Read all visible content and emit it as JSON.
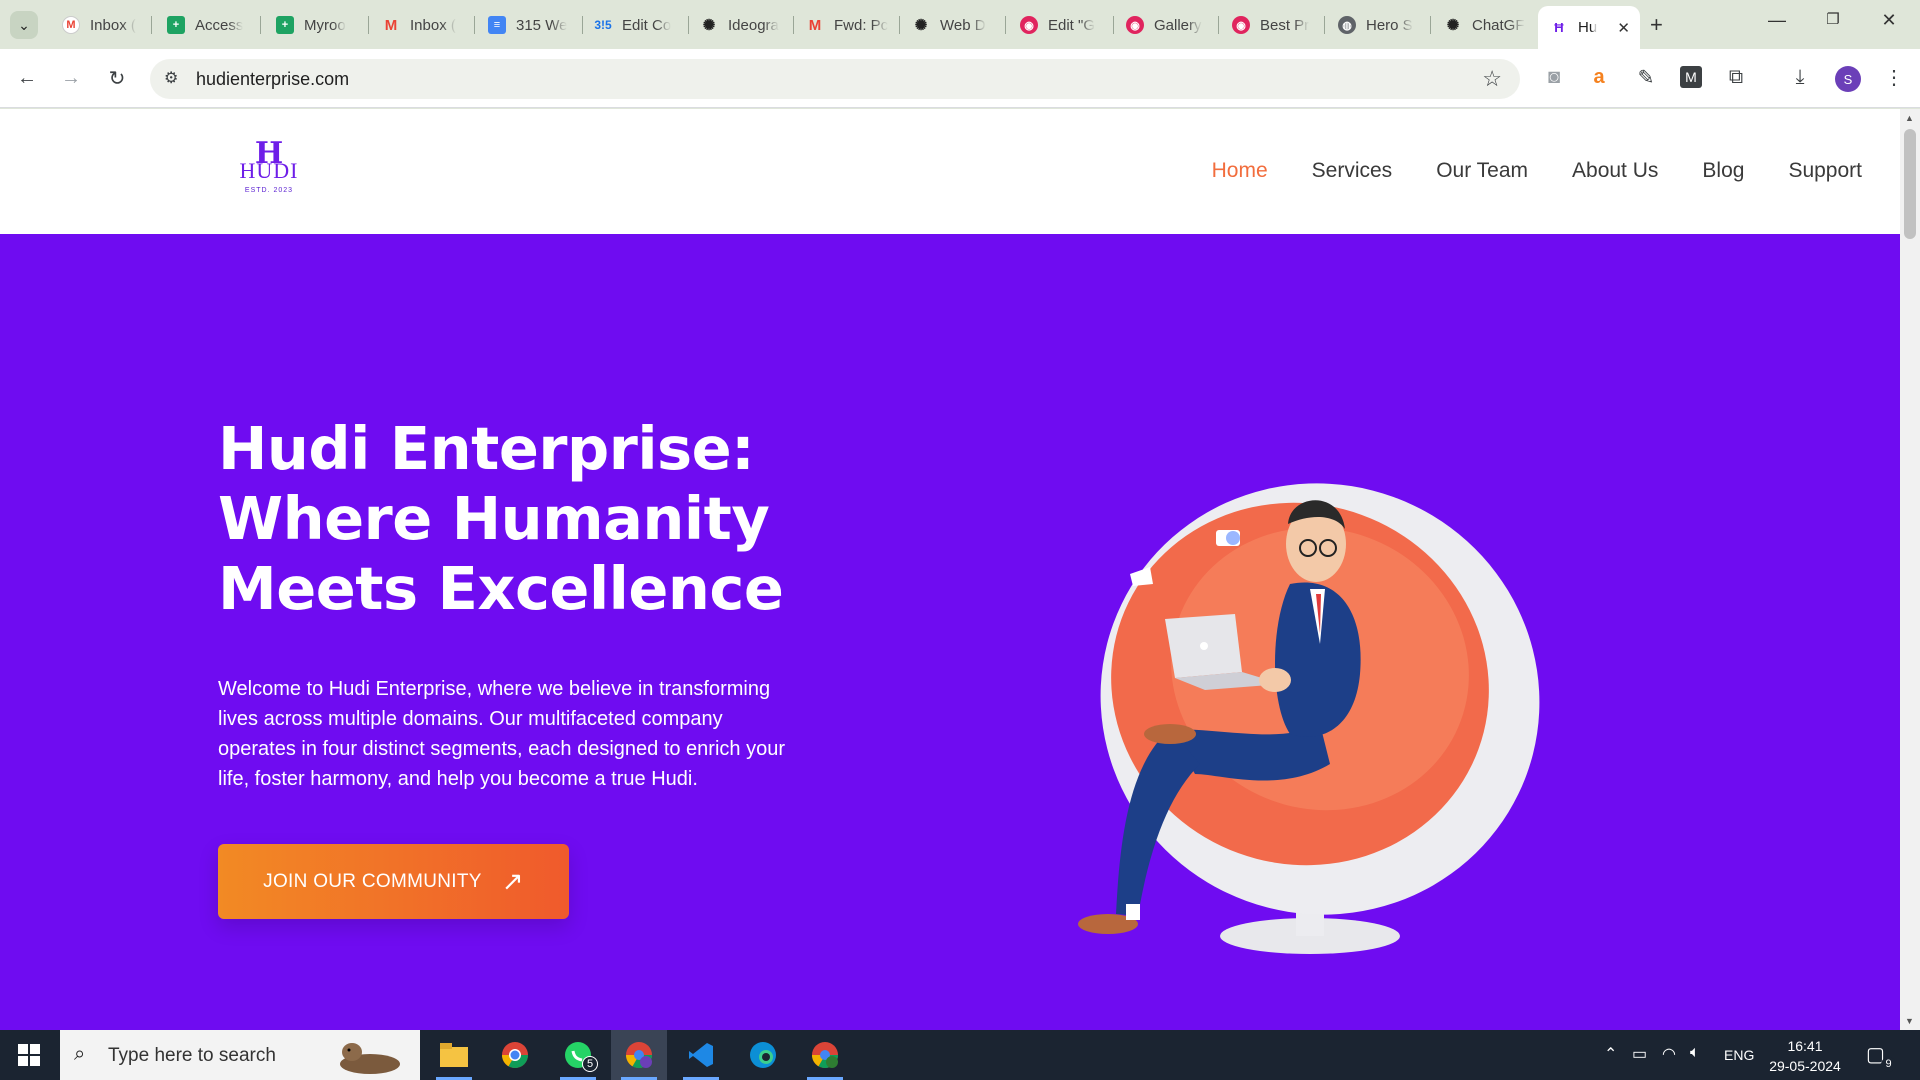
{
  "browser": {
    "tabs": [
      {
        "title": "Inbox (",
        "favicon": "gmail-icon"
      },
      {
        "title": "Access",
        "favicon": "sheets-icon"
      },
      {
        "title": "Myroo",
        "favicon": "sheets-icon"
      },
      {
        "title": "Inbox (",
        "favicon": "gmail-icon"
      },
      {
        "title": "315 We",
        "favicon": "docs-icon"
      },
      {
        "title": "Edit Co",
        "favicon": "315-icon"
      },
      {
        "title": "Ideogra",
        "favicon": "openai-icon"
      },
      {
        "title": "Fwd: Pc",
        "favicon": "gmail-icon"
      },
      {
        "title": "Web D",
        "favicon": "openai-icon"
      },
      {
        "title": "Edit \"G",
        "favicon": "app-icon"
      },
      {
        "title": "Gallery",
        "favicon": "app-icon"
      },
      {
        "title": "Best Pr",
        "favicon": "app-icon"
      },
      {
        "title": "Hero S",
        "favicon": "globe-icon"
      },
      {
        "title": "ChatGF",
        "favicon": "openai-icon"
      },
      {
        "title": "Hu",
        "favicon": "hudi-icon",
        "active": true
      }
    ],
    "new_tab": "+",
    "url": "hudienterprise.com",
    "profile_initial": "S",
    "colors": {
      "tabstrip": "#dfe6d9",
      "accent": "#6f0cf1"
    }
  },
  "site": {
    "logo": {
      "mark": "H",
      "word": "HUDI",
      "estd": "ESTD. 2023"
    },
    "nav": [
      "Home",
      "Services",
      "Our Team",
      "About Us",
      "Blog",
      "Support"
    ],
    "active_nav": "Home",
    "hero": {
      "title_lines": [
        "Hudi Enterprise:",
        "Where Humanity",
        "Meets Excellence"
      ],
      "body": "Welcome to Hudi Enterprise, where we believe in transforming lives across multiple domains. Our multifaceted company operates in four distinct segments, each designed to enrich your life, foster harmony, and help you become a true Hudi.",
      "cta": "JOIN OUR COMMUNITY"
    },
    "colors": {
      "hero_bg": "#6f0cf1",
      "nav_active": "#f26d3d",
      "cta_start": "#f28a24",
      "cta_end": "#f05a2c"
    }
  },
  "taskbar": {
    "search_placeholder": "Type here to search",
    "whatsapp_badge": "5",
    "language": "ENG",
    "time": "16:41",
    "date": "29-05-2024",
    "notification_count": "9"
  }
}
